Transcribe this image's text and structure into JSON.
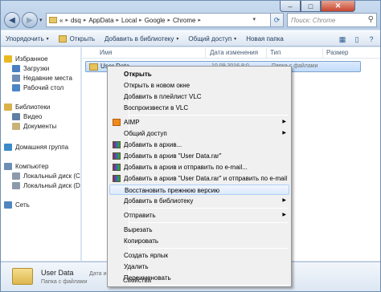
{
  "window": {
    "controls": {
      "minimize": "–",
      "maximize": "□",
      "close": "✕"
    }
  },
  "nav": {
    "back": "◀",
    "forward": "▶",
    "dropdown": "▾"
  },
  "address": {
    "chevron": "«",
    "segments": [
      "dsq",
      "AppData",
      "Local",
      "Google",
      "Chrome"
    ],
    "separator": "▸"
  },
  "search": {
    "placeholder": "Поиск: Chrome",
    "icon": "search-icon"
  },
  "toolbar": {
    "organize": "Упорядочить",
    "open": "Открыть",
    "add_library": "Добавить в библиотеку",
    "share": "Общий доступ",
    "new_folder": "Новая папка",
    "dropdown_arrow": "▾"
  },
  "sidebar": {
    "items": [
      {
        "label": "Избранное",
        "icon": "star-icon",
        "color": "#e8b923"
      },
      {
        "label": "Загрузки",
        "icon": "downloads-icon",
        "color": "#4a7fc1"
      },
      {
        "label": "Недавние места",
        "icon": "recent-places-icon",
        "color": "#6d8fb8"
      },
      {
        "label": "Рабочий стол",
        "icon": "desktop-icon",
        "color": "#4a86c8"
      },
      {
        "label": "Библиотеки",
        "icon": "libraries-icon",
        "color": "#d9b24a"
      },
      {
        "label": "Видео",
        "icon": "video-icon",
        "color": "#5d7fa6"
      },
      {
        "label": "Документы",
        "icon": "documents-icon",
        "color": "#c9b27a"
      },
      {
        "label": "Домашняя группа",
        "icon": "homegroup-icon",
        "color": "#3c8bc8"
      },
      {
        "label": "Компьютер",
        "icon": "computer-icon",
        "color": "#6c8fb3"
      },
      {
        "label": "Локальный диск (C",
        "icon": "drive-icon",
        "color": "#8c9aab"
      },
      {
        "label": "Локальный диск (D",
        "icon": "drive-icon",
        "color": "#8c9aab"
      },
      {
        "label": "Сеть",
        "icon": "network-icon",
        "color": "#4f86bf"
      }
    ]
  },
  "columns": {
    "name": "Имя",
    "date": "Дата изменения",
    "type": "Тип",
    "size": "Размер"
  },
  "files": [
    {
      "name": "User Data",
      "date": "10.09.2016 8:0",
      "type": "Папка с файлами"
    }
  ],
  "details": {
    "name": "User Data",
    "type": "Папка с файлами",
    "date_label": "Дата из"
  },
  "context_menu": {
    "items": [
      {
        "label": "Открыть",
        "bold": true
      },
      {
        "label": "Открыть в новом окне"
      },
      {
        "label": "Добавить в плейлист VLC"
      },
      {
        "label": "Воспроизвести в VLC"
      },
      {
        "label": "AIMP",
        "submenu": true,
        "icon": "aimp-icon"
      },
      {
        "label": "Общий доступ",
        "submenu": true
      },
      {
        "label": "Добавить в архив...",
        "icon": "winrar-icon"
      },
      {
        "label": "Добавить в архив \"User Data.rar\"",
        "icon": "winrar-icon"
      },
      {
        "label": "Добавить в архив и отправить по e-mail...",
        "icon": "winrar-icon"
      },
      {
        "label": "Добавить в архив \"User Data.rar\" и отправить по e-mail",
        "icon": "winrar-icon"
      },
      {
        "label": "Восстановить прежнюю версию",
        "highlighted": true
      },
      {
        "label": "Добавить в библиотеку",
        "submenu": true
      },
      {
        "label": "Отправить",
        "submenu": true
      },
      {
        "label": "Вырезать"
      },
      {
        "label": "Копировать"
      },
      {
        "label": "Создать ярлык"
      },
      {
        "label": "Удалить"
      },
      {
        "label": "Переименовать"
      },
      {
        "label": "Свойства"
      }
    ],
    "submenu_arrow": "▶"
  }
}
